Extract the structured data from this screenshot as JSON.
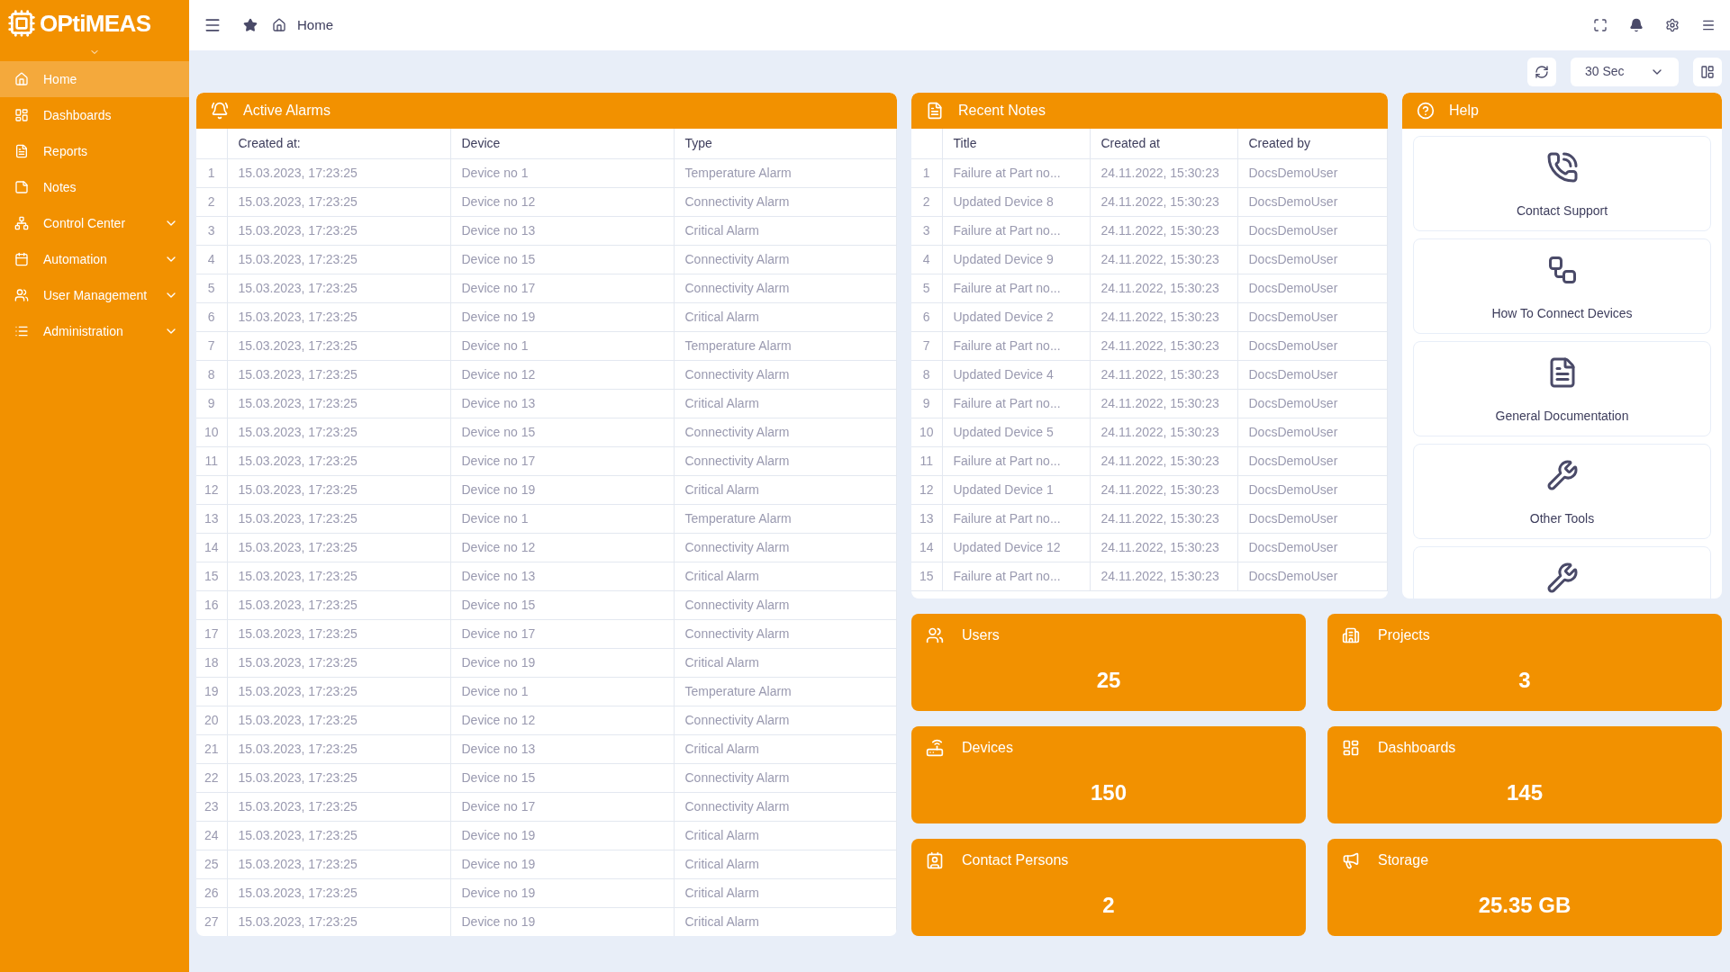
{
  "logo": {
    "text": "OPtiMEAS"
  },
  "breadcrumb": {
    "label": "Home"
  },
  "sidebar": {
    "items": [
      {
        "label": "Home",
        "kind": "home",
        "selected": true
      },
      {
        "label": "Dashboards",
        "kind": "dashboard",
        "selected": false
      },
      {
        "label": "Reports",
        "kind": "report",
        "selected": false
      },
      {
        "label": "Notes",
        "kind": "note",
        "selected": false
      },
      {
        "label": "Control Center",
        "kind": "network",
        "selected": false
      },
      {
        "label": "Automation",
        "kind": "calendar",
        "selected": false
      },
      {
        "label": "User Management",
        "kind": "users",
        "selected": false
      },
      {
        "label": "Administration",
        "kind": "list",
        "selected": false
      }
    ]
  },
  "toolbar": {
    "interval": "30 Sec"
  },
  "alarms": {
    "title": "Active Alarms",
    "columns": [
      "Created at:",
      "Device",
      "Type"
    ],
    "rows": [
      {
        "n": "1",
        "created": "15.03.2023, 17:23:25",
        "device": "Device no 1",
        "type": "Temperature Alarm"
      },
      {
        "n": "2",
        "created": "15.03.2023, 17:23:25",
        "device": "Device no 12",
        "type": "Connectivity Alarm"
      },
      {
        "n": "3",
        "created": "15.03.2023, 17:23:25",
        "device": "Device no 13",
        "type": "Critical Alarm"
      },
      {
        "n": "4",
        "created": "15.03.2023, 17:23:25",
        "device": "Device no 15",
        "type": "Connectivity Alarm"
      },
      {
        "n": "5",
        "created": "15.03.2023, 17:23:25",
        "device": "Device no 17",
        "type": "Connectivity Alarm"
      },
      {
        "n": "6",
        "created": "15.03.2023, 17:23:25",
        "device": "Device no 19",
        "type": "Critical Alarm"
      },
      {
        "n": "7",
        "created": "15.03.2023, 17:23:25",
        "device": "Device no 1",
        "type": "Temperature Alarm"
      },
      {
        "n": "8",
        "created": "15.03.2023, 17:23:25",
        "device": "Device no 12",
        "type": "Connectivity Alarm"
      },
      {
        "n": "9",
        "created": "15.03.2023, 17:23:25",
        "device": "Device no 13",
        "type": "Critical Alarm"
      },
      {
        "n": "10",
        "created": "15.03.2023, 17:23:25",
        "device": "Device no 15",
        "type": "Connectivity Alarm"
      },
      {
        "n": "11",
        "created": "15.03.2023, 17:23:25",
        "device": "Device no 17",
        "type": "Connectivity Alarm"
      },
      {
        "n": "12",
        "created": "15.03.2023, 17:23:25",
        "device": "Device no 19",
        "type": "Critical Alarm"
      },
      {
        "n": "13",
        "created": "15.03.2023, 17:23:25",
        "device": "Device no 1",
        "type": "Temperature Alarm"
      },
      {
        "n": "14",
        "created": "15.03.2023, 17:23:25",
        "device": "Device no 12",
        "type": "Connectivity Alarm"
      },
      {
        "n": "15",
        "created": "15.03.2023, 17:23:25",
        "device": "Device no 13",
        "type": "Critical Alarm"
      },
      {
        "n": "16",
        "created": "15.03.2023, 17:23:25",
        "device": "Device no 15",
        "type": "Connectivity Alarm"
      },
      {
        "n": "17",
        "created": "15.03.2023, 17:23:25",
        "device": "Device no 17",
        "type": "Connectivity Alarm"
      },
      {
        "n": "18",
        "created": "15.03.2023, 17:23:25",
        "device": "Device no 19",
        "type": "Critical Alarm"
      },
      {
        "n": "19",
        "created": "15.03.2023, 17:23:25",
        "device": "Device no 1",
        "type": "Temperature Alarm"
      },
      {
        "n": "20",
        "created": "15.03.2023, 17:23:25",
        "device": "Device no 12",
        "type": "Connectivity Alarm"
      },
      {
        "n": "21",
        "created": "15.03.2023, 17:23:25",
        "device": "Device no 13",
        "type": "Critical Alarm"
      },
      {
        "n": "22",
        "created": "15.03.2023, 17:23:25",
        "device": "Device no 15",
        "type": "Connectivity Alarm"
      },
      {
        "n": "23",
        "created": "15.03.2023, 17:23:25",
        "device": "Device no 17",
        "type": "Connectivity Alarm"
      },
      {
        "n": "24",
        "created": "15.03.2023, 17:23:25",
        "device": "Device no 19",
        "type": "Critical Alarm"
      },
      {
        "n": "25",
        "created": "15.03.2023, 17:23:25",
        "device": "Device no 19",
        "type": "Critical Alarm"
      },
      {
        "n": "26",
        "created": "15.03.2023, 17:23:25",
        "device": "Device no 19",
        "type": "Critical Alarm"
      },
      {
        "n": "27",
        "created": "15.03.2023, 17:23:25",
        "device": "Device no 19",
        "type": "Critical Alarm"
      }
    ]
  },
  "notes": {
    "title": "Recent Notes",
    "columns": [
      "Title",
      "Created at",
      "Created by"
    ],
    "rows": [
      {
        "n": "1",
        "title": "Failure at Part no...",
        "created": "24.11.2022, 15:30:23",
        "by": "DocsDemoUser"
      },
      {
        "n": "2",
        "title": "Updated Device 8",
        "created": "24.11.2022, 15:30:23",
        "by": "DocsDemoUser"
      },
      {
        "n": "3",
        "title": "Failure at Part no...",
        "created": "24.11.2022, 15:30:23",
        "by": "DocsDemoUser"
      },
      {
        "n": "4",
        "title": "Updated Device 9",
        "created": "24.11.2022, 15:30:23",
        "by": "DocsDemoUser"
      },
      {
        "n": "5",
        "title": "Failure at Part no...",
        "created": "24.11.2022, 15:30:23",
        "by": "DocsDemoUser"
      },
      {
        "n": "6",
        "title": "Updated Device 2",
        "created": "24.11.2022, 15:30:23",
        "by": "DocsDemoUser"
      },
      {
        "n": "7",
        "title": "Failure at Part no...",
        "created": "24.11.2022, 15:30:23",
        "by": "DocsDemoUser"
      },
      {
        "n": "8",
        "title": "Updated Device 4",
        "created": "24.11.2022, 15:30:23",
        "by": "DocsDemoUser"
      },
      {
        "n": "9",
        "title": "Failure at Part no...",
        "created": "24.11.2022, 15:30:23",
        "by": "DocsDemoUser"
      },
      {
        "n": "10",
        "title": "Updated Device 5",
        "created": "24.11.2022, 15:30:23",
        "by": "DocsDemoUser"
      },
      {
        "n": "11",
        "title": "Failure at Part no...",
        "created": "24.11.2022, 15:30:23",
        "by": "DocsDemoUser"
      },
      {
        "n": "12",
        "title": "Updated Device 1",
        "created": "24.11.2022, 15:30:23",
        "by": "DocsDemoUser"
      },
      {
        "n": "13",
        "title": "Failure at Part no...",
        "created": "24.11.2022, 15:30:23",
        "by": "DocsDemoUser"
      },
      {
        "n": "14",
        "title": "Updated Device 12",
        "created": "24.11.2022, 15:30:23",
        "by": "DocsDemoUser"
      },
      {
        "n": "15",
        "title": "Failure at Part no...",
        "created": "24.11.2022, 15:30:23",
        "by": "DocsDemoUser"
      }
    ]
  },
  "help": {
    "title": "Help",
    "items": [
      {
        "kind": "phone",
        "label": "Contact Support"
      },
      {
        "kind": "flow",
        "label": "How To Connect Devices"
      },
      {
        "kind": "doc",
        "label": "General Documentation"
      },
      {
        "kind": "tools",
        "label": "Other Tools"
      },
      {
        "kind": "tools"
      }
    ]
  },
  "stats": [
    {
      "kind": "users",
      "label": "Users",
      "value": "25"
    },
    {
      "kind": "projects",
      "label": "Projects",
      "value": "3"
    },
    {
      "kind": "router",
      "label": "Devices",
      "value": "150"
    },
    {
      "kind": "dashboard",
      "label": "Dashboards",
      "value": "145"
    },
    {
      "kind": "contact",
      "label": "Contact Persons",
      "value": "2"
    },
    {
      "kind": "megaphone",
      "label": "Storage",
      "value": "25.35 GB"
    }
  ]
}
